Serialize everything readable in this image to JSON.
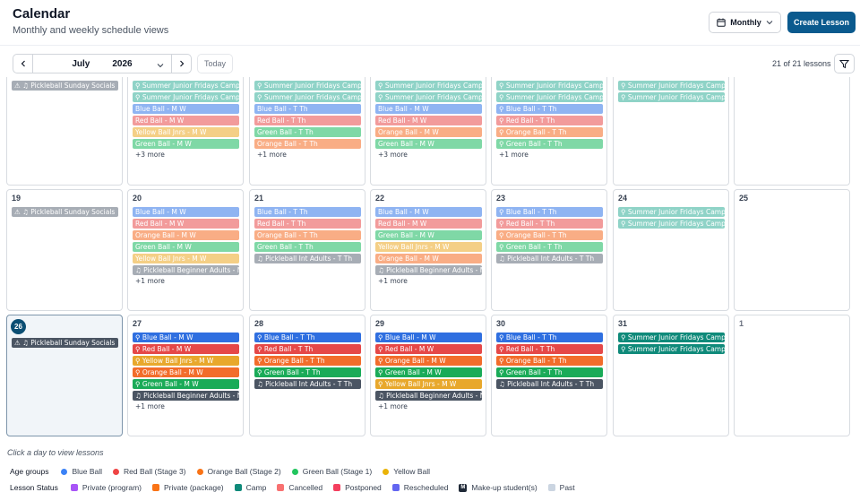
{
  "header": {
    "title": "Calendar",
    "subtitle": "Monthly and weekly schedule views",
    "view_label": "Monthly",
    "create_label": "Create Lesson"
  },
  "toolbar": {
    "month": "July",
    "year": "2026",
    "today_label": "Today",
    "count": "21 of 21 lessons"
  },
  "calendar": {
    "weeks": [
      [
        {
          "day": "",
          "events": [
            {
              "label": "⚠ ♫ Pickleball Sunday Socials",
              "kind": "pb"
            }
          ],
          "more": ""
        },
        {
          "day": "",
          "events": [
            {
              "label": "⚲ Summer Junior Fridays Camp...",
              "kind": "camp"
            },
            {
              "label": "⚲ Summer Junior Fridays Camp...",
              "kind": "camp"
            },
            {
              "label": "Blue Ball - M W",
              "kind": "blue"
            },
            {
              "label": "Red Ball - M W",
              "kind": "red"
            },
            {
              "label": "Yellow Ball Jnrs - M W",
              "kind": "yellow"
            },
            {
              "label": "Green Ball - M W",
              "kind": "green"
            }
          ],
          "more": "+3 more"
        },
        {
          "day": "",
          "events": [
            {
              "label": "⚲ Summer Junior Fridays Camp...",
              "kind": "camp"
            },
            {
              "label": "⚲ Summer Junior Fridays Camp...",
              "kind": "camp"
            },
            {
              "label": "Blue Ball - T Th",
              "kind": "blue"
            },
            {
              "label": "Red Ball - T Th",
              "kind": "red"
            },
            {
              "label": "Green Ball - T Th",
              "kind": "green"
            },
            {
              "label": "Orange Ball - T Th",
              "kind": "orange"
            }
          ],
          "more": "+1 more"
        },
        {
          "day": "",
          "events": [
            {
              "label": "⚲ Summer Junior Fridays Camp...",
              "kind": "camp"
            },
            {
              "label": "⚲ Summer Junior Fridays Camp...",
              "kind": "camp"
            },
            {
              "label": "Blue Ball - M W",
              "kind": "blue"
            },
            {
              "label": "Red Ball - M W",
              "kind": "red"
            },
            {
              "label": "Orange Ball - M W",
              "kind": "orange"
            },
            {
              "label": "Green Ball - M W",
              "kind": "green"
            }
          ],
          "more": "+3 more"
        },
        {
          "day": "",
          "events": [
            {
              "label": "⚲ Summer Junior Fridays Camp...",
              "kind": "camp"
            },
            {
              "label": "⚲ Summer Junior Fridays Camp...",
              "kind": "camp"
            },
            {
              "label": "⚲ Blue Ball - T Th",
              "kind": "blue"
            },
            {
              "label": "⚲ Red Ball - T Th",
              "kind": "red"
            },
            {
              "label": "⚲ Orange Ball - T Th",
              "kind": "orange"
            },
            {
              "label": "⚲ Green Ball - T Th",
              "kind": "green"
            }
          ],
          "more": "+1 more"
        },
        {
          "day": "",
          "events": [
            {
              "label": "⚲ Summer Junior Fridays Camp...",
              "kind": "camp"
            },
            {
              "label": "⚲ Summer Junior Fridays Camp...",
              "kind": "camp"
            }
          ],
          "more": ""
        },
        {
          "day": "",
          "events": [],
          "more": ""
        }
      ],
      [
        {
          "day": "19",
          "events": [
            {
              "label": "⚠ ♫ Pickleball Sunday Socials",
              "kind": "pb"
            }
          ],
          "more": ""
        },
        {
          "day": "20",
          "events": [
            {
              "label": "Blue Ball - M W",
              "kind": "blue"
            },
            {
              "label": "Red Ball - M W",
              "kind": "red"
            },
            {
              "label": "Orange Ball - M W",
              "kind": "orange"
            },
            {
              "label": "Green Ball - M W",
              "kind": "green"
            },
            {
              "label": "Yellow Ball Jnrs - M W",
              "kind": "yellow"
            },
            {
              "label": "♫ Pickleball Beginner Adults - M...",
              "kind": "pb"
            }
          ],
          "more": "+1 more"
        },
        {
          "day": "21",
          "events": [
            {
              "label": "Blue Ball - T Th",
              "kind": "blue"
            },
            {
              "label": "Red Ball - T Th",
              "kind": "red"
            },
            {
              "label": "Orange Ball - T Th",
              "kind": "orange"
            },
            {
              "label": "Green Ball - T Th",
              "kind": "green"
            },
            {
              "label": "♫ Pickleball Int Adults - T Th",
              "kind": "pb"
            }
          ],
          "more": ""
        },
        {
          "day": "22",
          "events": [
            {
              "label": "Blue Ball - M W",
              "kind": "blue"
            },
            {
              "label": "Red Ball - M W",
              "kind": "red"
            },
            {
              "label": "Green Ball - M W",
              "kind": "green"
            },
            {
              "label": "Yellow Ball Jnrs - M W",
              "kind": "yellow"
            },
            {
              "label": "Orange Ball - M W",
              "kind": "orange"
            },
            {
              "label": "♫ Pickleball Beginner Adults - M...",
              "kind": "pb"
            }
          ],
          "more": "+1 more"
        },
        {
          "day": "23",
          "events": [
            {
              "label": "⚲ Blue Ball - T Th",
              "kind": "blue"
            },
            {
              "label": "⚲ Red Ball - T Th",
              "kind": "red"
            },
            {
              "label": "⚲ Orange Ball - T Th",
              "kind": "orange"
            },
            {
              "label": "⚲ Green Ball - T Th",
              "kind": "green"
            },
            {
              "label": "♫ Pickleball Int Adults - T Th",
              "kind": "pb"
            }
          ],
          "more": ""
        },
        {
          "day": "24",
          "events": [
            {
              "label": "⚲ Summer Junior Fridays Camp...",
              "kind": "camp"
            },
            {
              "label": "⚲ Summer Junior Fridays Camp...",
              "kind": "camp"
            }
          ],
          "more": ""
        },
        {
          "day": "25",
          "events": [],
          "more": ""
        }
      ],
      [
        {
          "day": "26",
          "today": true,
          "events": [
            {
              "label": "⚠ ♫ Pickleball Sunday Socials",
              "kind": "pb_dark"
            }
          ],
          "more": ""
        },
        {
          "day": "27",
          "events": [
            {
              "label": "⚲ Blue Ball - M W",
              "kind": "blue_s"
            },
            {
              "label": "⚲ Red Ball - M W",
              "kind": "red_s"
            },
            {
              "label": "⚲ Yellow Ball Jnrs - M W",
              "kind": "yellow_s"
            },
            {
              "label": "⚲ Orange Ball - M W",
              "kind": "orange_s"
            },
            {
              "label": "⚲ Green Ball - M W",
              "kind": "green_s"
            },
            {
              "label": "♫ Pickleball Beginner Adults - M...",
              "kind": "pb_dark"
            }
          ],
          "more": "+1 more"
        },
        {
          "day": "28",
          "events": [
            {
              "label": "⚲ Blue Ball - T Th",
              "kind": "blue_s"
            },
            {
              "label": "⚲ Red Ball - T Th",
              "kind": "red_s"
            },
            {
              "label": "⚲ Orange Ball - T Th",
              "kind": "orange_s"
            },
            {
              "label": "⚲ Green Ball - T Th",
              "kind": "green_s"
            },
            {
              "label": "♫ Pickleball Int Adults - T Th",
              "kind": "pb_dark"
            }
          ],
          "more": ""
        },
        {
          "day": "29",
          "events": [
            {
              "label": "⚲ Blue Ball - M W",
              "kind": "blue_s"
            },
            {
              "label": "⚲ Red Ball - M W",
              "kind": "red_s"
            },
            {
              "label": "⚲ Orange Ball - M W",
              "kind": "orange_s"
            },
            {
              "label": "⚲ Green Ball - M W",
              "kind": "green_s"
            },
            {
              "label": "⚲ Yellow Ball Jnrs - M W",
              "kind": "yellow_s"
            },
            {
              "label": "♫ Pickleball Beginner Adults - M...",
              "kind": "pb_dark"
            }
          ],
          "more": "+1 more"
        },
        {
          "day": "30",
          "events": [
            {
              "label": "⚲ Blue Ball - T Th",
              "kind": "blue_s"
            },
            {
              "label": "⚲ Red Ball - T Th",
              "kind": "red_s"
            },
            {
              "label": "⚲ Orange Ball - T Th",
              "kind": "orange_s"
            },
            {
              "label": "⚲ Green Ball - T Th",
              "kind": "green_s"
            },
            {
              "label": "♫ Pickleball Int Adults - T Th",
              "kind": "pb_dark"
            }
          ],
          "more": ""
        },
        {
          "day": "31",
          "events": [
            {
              "label": "⚲ Summer Junior Fridays Camp...",
              "kind": "camp_s"
            },
            {
              "label": "⚲ Summer Junior Fridays Camp...",
              "kind": "camp_s"
            }
          ],
          "more": ""
        },
        {
          "day": "1",
          "other": true,
          "events": [],
          "more": ""
        }
      ]
    ]
  },
  "event_colors": {
    "camp": {
      "bg": "#8fd3c7",
      "fg": "#ffffff"
    },
    "blue": {
      "bg": "#8fb4f2",
      "fg": "#ffffff"
    },
    "red": {
      "bg": "#f29b9b",
      "fg": "#ffffff"
    },
    "yellow": {
      "bg": "#f4cf86",
      "fg": "#ffffff"
    },
    "green": {
      "bg": "#7fd8a6",
      "fg": "#ffffff"
    },
    "orange": {
      "bg": "#f9ad85",
      "fg": "#ffffff"
    },
    "pb": {
      "bg": "#a7adb5",
      "fg": "#ffffff"
    },
    "camp_s": {
      "bg": "#0f8a7a",
      "fg": "#ffffff"
    },
    "blue_s": {
      "bg": "#2f6fe0",
      "fg": "#ffffff"
    },
    "red_s": {
      "bg": "#e54848",
      "fg": "#ffffff"
    },
    "yellow_s": {
      "bg": "#e8a82c",
      "fg": "#ffffff"
    },
    "green_s": {
      "bg": "#1aab58",
      "fg": "#ffffff"
    },
    "orange_s": {
      "bg": "#f26d2b",
      "fg": "#ffffff"
    },
    "pb_dark": {
      "bg": "#4b5563",
      "fg": "#ffffff"
    }
  },
  "footer": {
    "hint": "Click a day to view lessons",
    "age_groups_title": "Age groups",
    "age_groups": [
      {
        "label": "Blue Ball",
        "color": "#3b82f6"
      },
      {
        "label": "Red Ball (Stage 3)",
        "color": "#ef4444"
      },
      {
        "label": "Orange Ball (Stage 2)",
        "color": "#f97316"
      },
      {
        "label": "Green Ball (Stage 1)",
        "color": "#22c55e"
      },
      {
        "label": "Yellow Ball",
        "color": "#eab308"
      }
    ],
    "status_title": "Lesson Status",
    "statuses": [
      {
        "label": "Private (program)",
        "color": "#a855f7",
        "type": "sq"
      },
      {
        "label": "Private (package)",
        "color": "#f97316",
        "type": "sq"
      },
      {
        "label": "Camp",
        "color": "#0f8a7a",
        "type": "sq"
      },
      {
        "label": "Cancelled",
        "color": "#f87171",
        "type": "sq"
      },
      {
        "label": "Postponed",
        "color": "#f43f5e",
        "type": "sq"
      },
      {
        "label": "Rescheduled",
        "color": "#6366f1",
        "type": "sq"
      },
      {
        "label": "Make-up student(s)",
        "color": "#1f2937",
        "type": "m",
        "glyph": "M"
      },
      {
        "label": "Past",
        "color": "#cbd5e1",
        "type": "sq"
      }
    ]
  }
}
